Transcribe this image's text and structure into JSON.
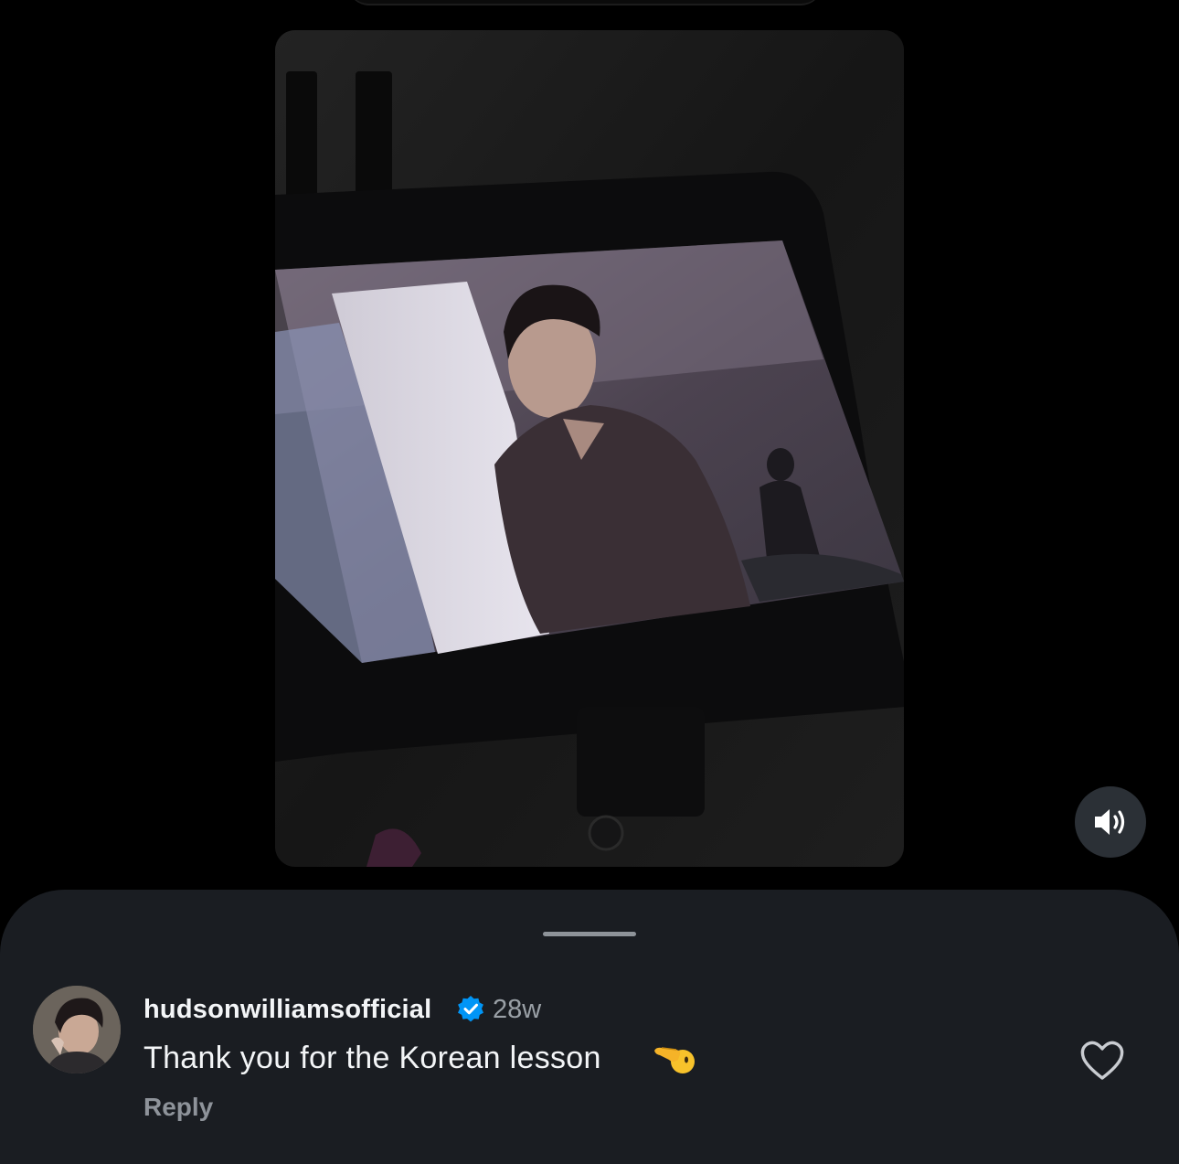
{
  "comment": {
    "username": "hudsonwilliamsofficial",
    "time_ago": "28w",
    "text": "Thank you for the Korean lesson",
    "reply_label": "Reply"
  },
  "icons": {
    "volume": "volume-on-icon",
    "verified": "verified-badge-icon",
    "like": "heart-outline-icon",
    "emoji": "pointing-left-hand-emoji"
  },
  "colors": {
    "sheet_background": "#1a1d22",
    "verified_blue": "#0095f6",
    "username_text": "#f3f5f7",
    "secondary_text": "#9aa0a6"
  }
}
